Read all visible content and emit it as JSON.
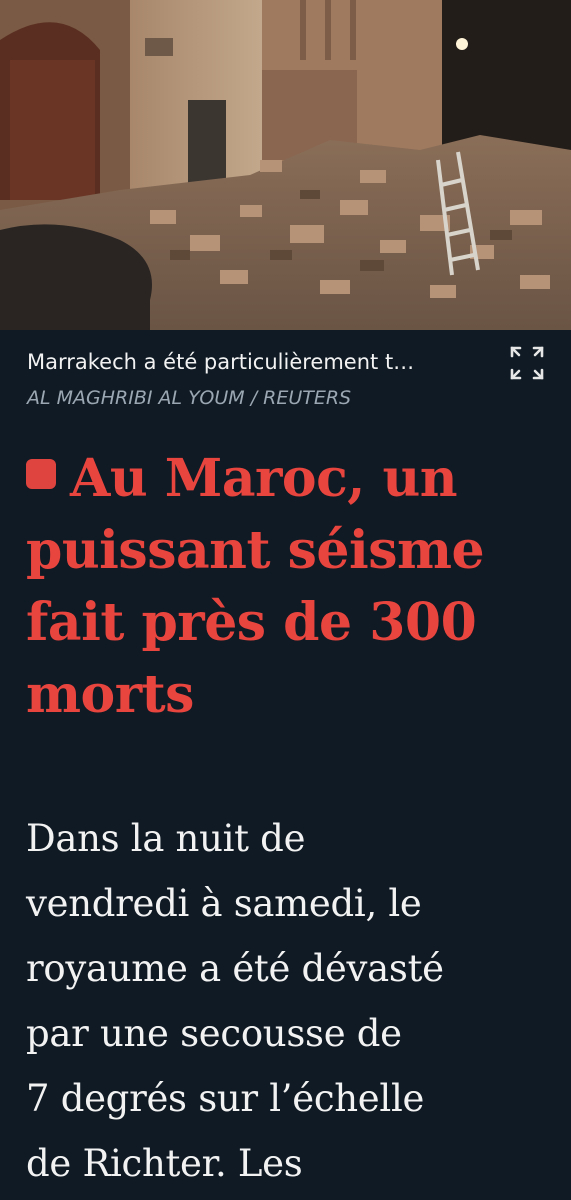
{
  "photo": {
    "caption": "Marrakech a été particulièrement t…",
    "credit": "AL MAGHRIBI AL YOUM / REUTERS",
    "expand_icon": "expand-icon"
  },
  "article": {
    "live_marker_color": "#e0443e",
    "title": "Au Maroc, un puissant séisme fait près de 300 morts",
    "lede_lines": [
      "Dans la nuit de",
      "vendredi à samedi, le",
      "royaume a été dévasté",
      "par une secousse de",
      "7 degrés sur l’échelle",
      "de Richter. Les"
    ]
  },
  "colors": {
    "background": "#0f1a24",
    "title": "#e8453f",
    "credit": "#9ba7b2"
  }
}
